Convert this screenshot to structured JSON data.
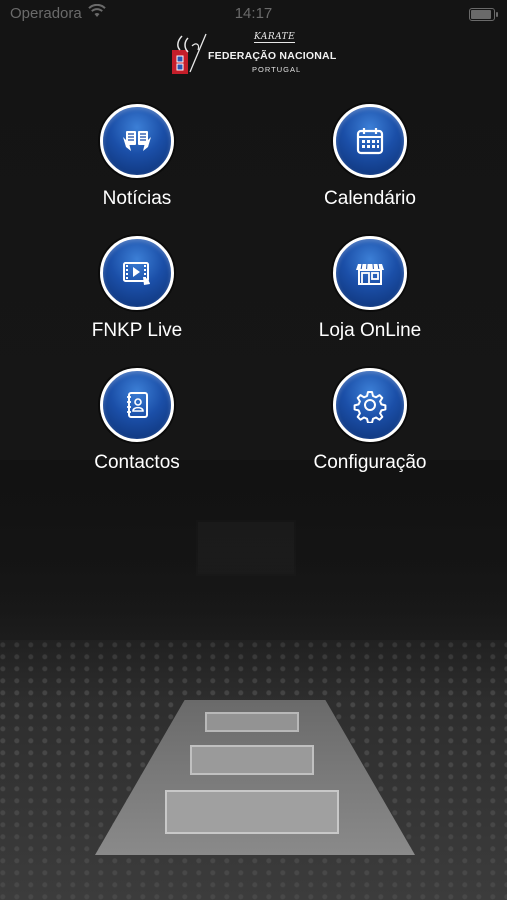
{
  "status_bar": {
    "carrier": "Operadora",
    "time": "14:17"
  },
  "header": {
    "logo_top": "KARATE",
    "logo_main": "FEDERAÇÃO NACIONAL",
    "logo_sub": "PORTUGAL"
  },
  "menu": {
    "items": [
      {
        "label": "Notícias",
        "icon": "news-reader-icon"
      },
      {
        "label": "Calendário",
        "icon": "calendar-icon"
      },
      {
        "label": "FNKP Live",
        "icon": "video-play-icon"
      },
      {
        "label": "Loja OnLine",
        "icon": "store-icon"
      },
      {
        "label": "Contactos",
        "icon": "contacts-book-icon"
      },
      {
        "label": "Configuração",
        "icon": "gear-icon"
      }
    ]
  },
  "colors": {
    "background": "#121212",
    "button_blue": "#1b4fa8",
    "button_border": "#ffffff",
    "text": "#ffffff"
  }
}
